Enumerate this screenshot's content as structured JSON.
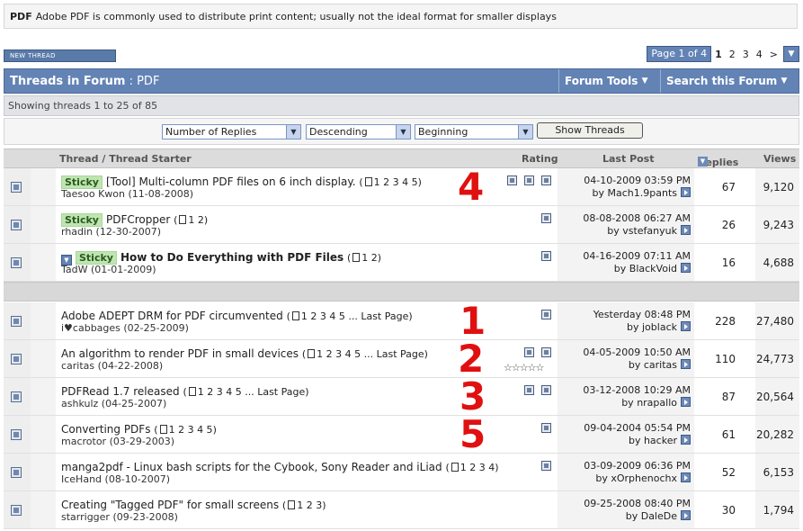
{
  "forum_description": {
    "name": "PDF",
    "text": "Adobe PDF is commonly used to distribute print content; usually not the ideal format for smaller displays"
  },
  "new_thread_label": "NEW THREAD",
  "pager": {
    "label": "Page 1 of 4",
    "pages": [
      "1",
      "2",
      "3",
      "4"
    ],
    "next": ">",
    "menu_icon": "down-arrow-icon"
  },
  "header": {
    "title": "Threads in Forum",
    "separator": " : ",
    "forum": "PDF",
    "tools": "Forum Tools",
    "search": "Search this Forum"
  },
  "showing": "Showing threads 1 to 25 of 85",
  "sort": {
    "field": "Number of Replies",
    "order": "Descending",
    "from": "Beginning",
    "button": "Show Threads"
  },
  "columns": {
    "thread": "Thread / Thread Starter",
    "rating": "Rating",
    "last_post": "Last Post",
    "replies": "Replies",
    "views": "Views"
  },
  "sticky_label": "Sticky",
  "page_icon": "multipage-icon",
  "go_icon": "go-to-last-post-icon",
  "annotation_color": "#e01010",
  "threads": [
    {
      "title": "[Tool] Multi-column PDF files on 6 inch display.",
      "pages": "1 2 3 4 5",
      "starter": "Taesoo Kwon (11-08-2008)",
      "date": "04-10-2009 03:59 PM",
      "by": "by Mach1.9pants",
      "replies": "67",
      "views": "9,120",
      "annotation": "4"
    },
    {
      "title": "PDFCropper",
      "pages": "1 2",
      "starter": "rhadin (12-30-2007)",
      "date": "08-08-2008 06:27 AM",
      "by": "by vstefanyuk",
      "replies": "26",
      "views": "9,243"
    },
    {
      "title": "How to Do Everything with PDF Files",
      "pages": "1 2",
      "starter": "TadW (01-01-2009)",
      "date": "04-16-2009 07:11 AM",
      "by": "by BlackVoid",
      "replies": "16",
      "views": "4,688"
    },
    {
      "title": "Adobe ADEPT DRM for PDF circumvented",
      "pages": "1 2 3 4 5 ... Last Page",
      "starter": "i♥cabbages (02-25-2009)",
      "date": "Yesterday 08:48 PM",
      "by": "by joblack",
      "replies": "228",
      "views": "27,480",
      "annotation": "1"
    },
    {
      "title": "An algorithm to render PDF in small devices",
      "pages": "1 2 3 4 5 ... Last Page",
      "starter": "caritas (04-22-2008)",
      "date": "04-05-2009 10:50 AM",
      "by": "by caritas",
      "replies": "110",
      "views": "24,773",
      "annotation": "2",
      "stars": "☆☆☆☆☆"
    },
    {
      "title": "PDFRead 1.7 released",
      "pages": "1 2 3 4 5 ... Last Page",
      "starter": "ashkulz (04-25-2007)",
      "date": "03-12-2008 10:29 AM",
      "by": "by nrapallo",
      "replies": "87",
      "views": "20,564",
      "annotation": "3"
    },
    {
      "title": "Converting PDFs",
      "pages": "1 2 3 4 5",
      "starter": "macrotor (03-29-2003)",
      "date": "09-04-2004 05:54 PM",
      "by": "by hacker",
      "replies": "61",
      "views": "20,282",
      "annotation": "5"
    },
    {
      "title": "manga2pdf - Linux bash scripts for the Cybook, Sony Reader and iLiad",
      "pages": "1 2 3 4",
      "starter": "IceHand (08-10-2007)",
      "date": "03-09-2009 06:36 PM",
      "by": "by xOrphenochx",
      "replies": "52",
      "views": "6,153"
    },
    {
      "title": "Creating \"Tagged PDF\" for small screens",
      "pages": "1 2 3",
      "starter": "starrigger (09-23-2008)",
      "date": "09-25-2008 08:40 PM",
      "by": "by DaleDe",
      "replies": "30",
      "views": "1,794"
    }
  ]
}
